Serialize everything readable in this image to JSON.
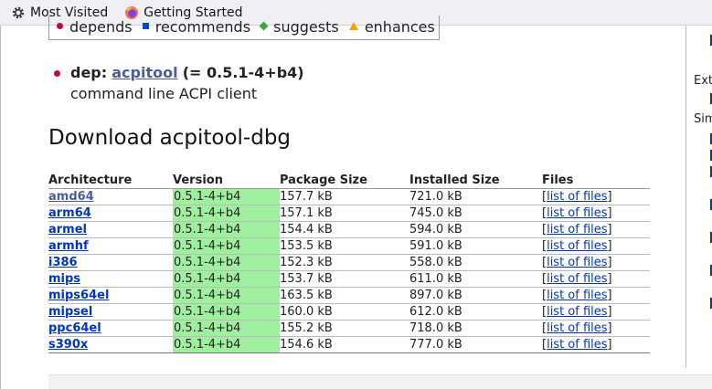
{
  "bookmarks": [
    {
      "label": "Most Visited",
      "icon": "gear-icon"
    },
    {
      "label": "Getting Started",
      "icon": "firefox-icon"
    }
  ],
  "legend": {
    "items": [
      {
        "label": "depends",
        "marker": "red-dot",
        "color": "#c7053d"
      },
      {
        "label": "recommends",
        "marker": "blue-square",
        "color": "#1446b8"
      },
      {
        "label": "suggests",
        "marker": "green-diamond",
        "color": "#3aa83a"
      },
      {
        "label": "enhances",
        "marker": "orange-triangle",
        "color": "#f0a30a"
      }
    ]
  },
  "dependency": {
    "prefix": "dep:",
    "package": "acpitool",
    "version": "(= 0.5.1-4+b4)",
    "description": "command line ACPI client"
  },
  "download_title": "Download acpitool-dbg",
  "table": {
    "headers": [
      "Architecture",
      "Version",
      "Package Size",
      "Installed Size",
      "Files"
    ],
    "rows": [
      {
        "arch": "amd64",
        "version": "0.5.1-4+b4",
        "size": "157.7 kB",
        "installed": "721.0 kB",
        "files": "list of files"
      },
      {
        "arch": "arm64",
        "version": "0.5.1-4+b4",
        "size": "157.1 kB",
        "installed": "745.0 kB",
        "files": "list of files"
      },
      {
        "arch": "armel",
        "version": "0.5.1-4+b4",
        "size": "154.4 kB",
        "installed": "594.0 kB",
        "files": "list of files"
      },
      {
        "arch": "armhf",
        "version": "0.5.1-4+b4",
        "size": "153.5 kB",
        "installed": "591.0 kB",
        "files": "list of files"
      },
      {
        "arch": "i386",
        "version": "0.5.1-4+b4",
        "size": "152.3 kB",
        "installed": "558.0 kB",
        "files": "list of files"
      },
      {
        "arch": "mips",
        "version": "0.5.1-4+b4",
        "size": "153.7 kB",
        "installed": "611.0 kB",
        "files": "list of files"
      },
      {
        "arch": "mips64el",
        "version": "0.5.1-4+b4",
        "size": "163.5 kB",
        "installed": "897.0 kB",
        "files": "list of files"
      },
      {
        "arch": "mipsel",
        "version": "0.5.1-4+b4",
        "size": "160.0 kB",
        "installed": "612.0 kB",
        "files": "list of files"
      },
      {
        "arch": "ppc64el",
        "version": "0.5.1-4+b4",
        "size": "155.2 kB",
        "installed": "718.0 kB",
        "files": "list of files"
      },
      {
        "arch": "s390x",
        "version": "0.5.1-4+b4",
        "size": "154.6 kB",
        "installed": "777.0 kB",
        "files": "list of files"
      }
    ]
  },
  "sidebar": {
    "labels": [
      "Ext",
      "Sim"
    ]
  },
  "colors": {
    "link": "#0035c7",
    "visited_link": "#4a5c9c",
    "version_bg": "#9ef09e"
  }
}
